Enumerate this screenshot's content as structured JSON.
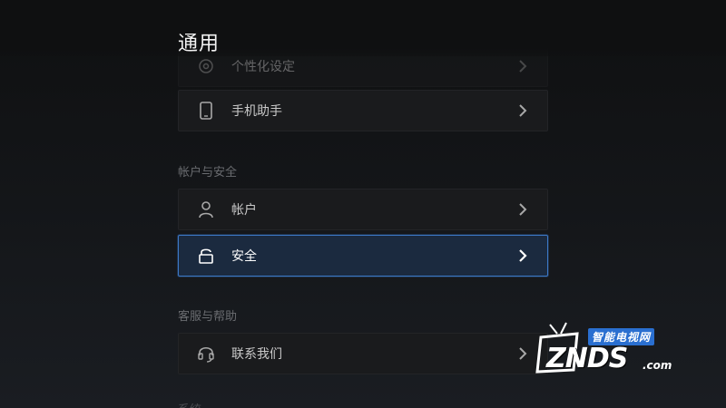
{
  "header": {
    "title": "通用"
  },
  "rows": {
    "personalize": {
      "label": "个性化设定",
      "icon": "personalize-icon"
    },
    "phone_assistant": {
      "label": "手机助手",
      "icon": "phone-icon"
    },
    "account": {
      "label": "帐户",
      "icon": "user-icon"
    },
    "security": {
      "label": "安全",
      "icon": "lock-icon",
      "selected": true
    },
    "contact": {
      "label": "联系我们",
      "icon": "headset-icon"
    }
  },
  "sections": {
    "account_security": "帐户与安全",
    "support": "客服与帮助",
    "next": "系统"
  },
  "watermark": {
    "top": "智能电视网",
    "main": "ZNDS",
    "domain": ".com"
  },
  "colors": {
    "accent_border": "#3c78c6",
    "selected_bg": "#1b2a3f",
    "row_bg": "#1a1b1d",
    "section_text": "#6a6c70"
  }
}
